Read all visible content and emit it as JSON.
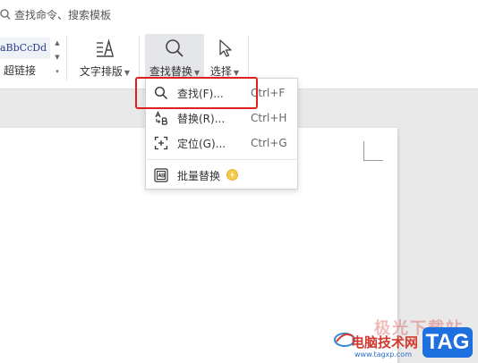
{
  "search": {
    "label": "查找命令、搜索模板",
    "icon": "search-icon"
  },
  "ribbon": {
    "style_preview_text": "aBbCcDd",
    "hyperlink_label": "超链接",
    "text_layout_label": "文字排版",
    "find_replace_label": "查找替换",
    "select_label": "选择"
  },
  "menu": {
    "items": [
      {
        "label": "查找(F)...",
        "shortcut": "Ctrl+F",
        "icon": "search-icon"
      },
      {
        "label": "替换(R)...",
        "shortcut": "Ctrl+H",
        "icon": "replace-icon"
      },
      {
        "label": "定位(G)...",
        "shortcut": "Ctrl+G",
        "icon": "locate-icon"
      },
      {
        "label": "批量替换",
        "shortcut": "",
        "icon": "batch-replace-icon"
      }
    ]
  },
  "watermark": {
    "top_text": "极光下载站",
    "main_text": "电脑技术网",
    "url": "www.tagxp.com",
    "logo": "TAG"
  },
  "colors": {
    "highlight": "#e02020",
    "brand_blue": "#1e6fe0",
    "style_text": "#2a3c88"
  }
}
